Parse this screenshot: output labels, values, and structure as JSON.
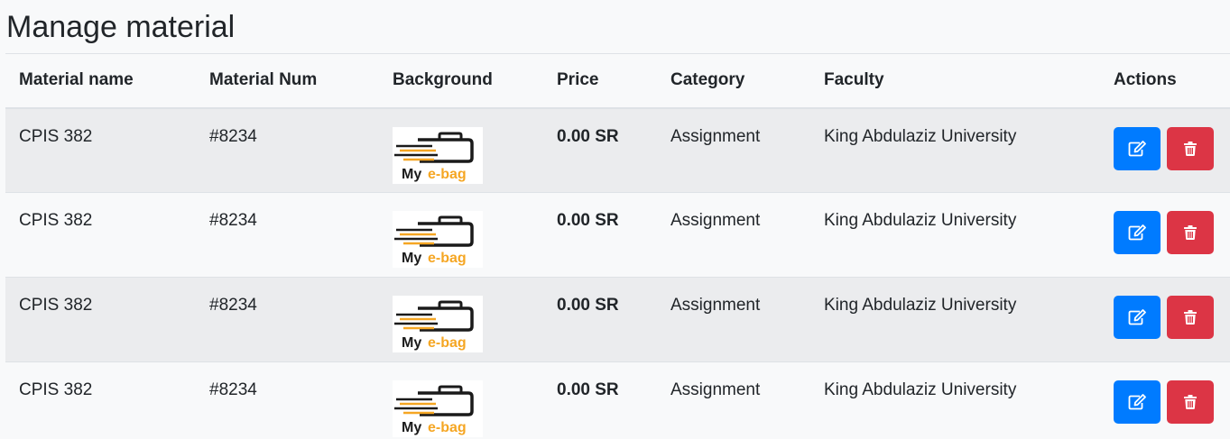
{
  "page": {
    "title": "Manage material"
  },
  "table": {
    "columns": [
      "Material name",
      "Material Num",
      "Background",
      "Price",
      "Category",
      "Faculty",
      "Actions"
    ],
    "rows": [
      {
        "name": "CPIS 382",
        "num": "#8234",
        "price": "0.00 SR",
        "category": "Assignment",
        "faculty": "King Abdulaziz University",
        "logo_my": "My",
        "logo_ebag": "e-bag"
      },
      {
        "name": "CPIS 382",
        "num": "#8234",
        "price": "0.00 SR",
        "category": "Assignment",
        "faculty": "King Abdulaziz University",
        "logo_my": "My",
        "logo_ebag": "e-bag"
      },
      {
        "name": "CPIS 382",
        "num": "#8234",
        "price": "0.00 SR",
        "category": "Assignment",
        "faculty": "King Abdulaziz University",
        "logo_my": "My",
        "logo_ebag": "e-bag"
      },
      {
        "name": "CPIS 382",
        "num": "#8234",
        "price": "0.00 SR",
        "category": "Assignment",
        "faculty": "King Abdulaziz University",
        "logo_my": "My",
        "logo_ebag": "e-bag"
      }
    ]
  },
  "icons": {
    "edit": "edit-icon",
    "delete": "trash-icon"
  },
  "colors": {
    "edit_button": "#007bff",
    "delete_button": "#dc3545",
    "logo_orange": "#f5a623",
    "striped_row": "#ebecee",
    "background": "#f8f9fa"
  }
}
